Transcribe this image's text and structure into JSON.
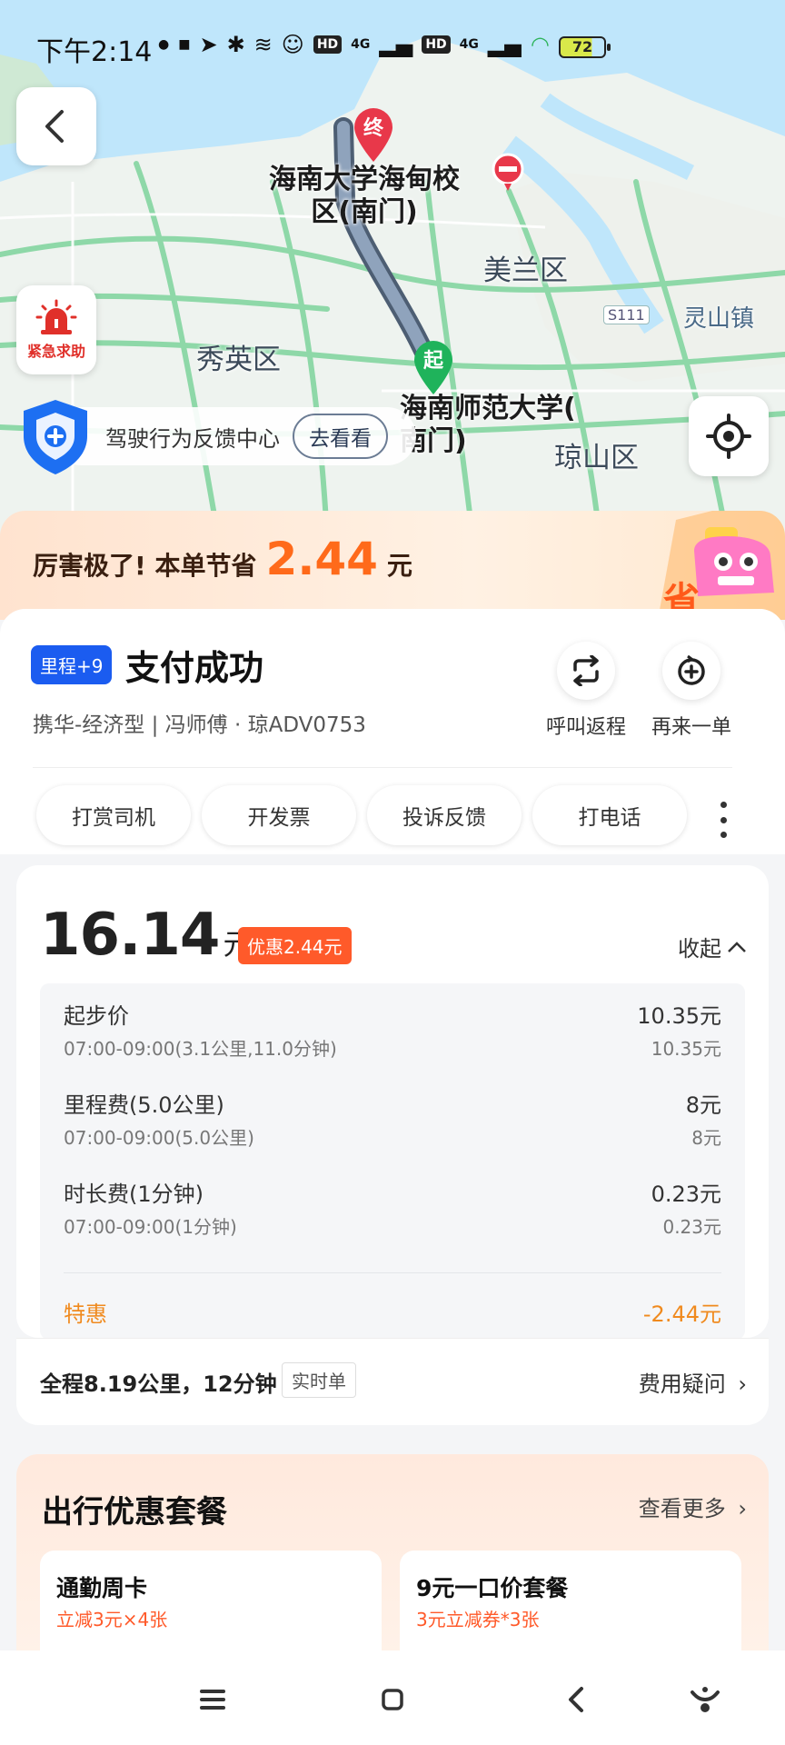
{
  "status_bar": {
    "time": "下午2:14",
    "net1": "4G",
    "net2": "4G",
    "hd": "HD",
    "battery": "72"
  },
  "map": {
    "labels": {
      "end_place": "海南大学海甸校\n区(南门)",
      "start_place": "海南师范大学(\n南门)",
      "district_meilan": "美兰区",
      "district_xiuying": "秀英区",
      "district_qiongshan": "琼山区",
      "town_lingshan": "灵山镇",
      "road_s111": "S111"
    },
    "end_pin": "终",
    "start_pin": "起",
    "sos_label": "紧急求助",
    "feedback": {
      "label": "驾驶行为反馈中心",
      "action": "去看看"
    }
  },
  "savings": {
    "prefix": "厉害极了! 本单节省",
    "amount": "2.44",
    "unit": "元"
  },
  "order": {
    "mileage_badge": "里程+9",
    "status": "支付成功",
    "subtitle": "携华-经济型 | 冯师傅 · 琼ADV0753",
    "return_trip": "呼叫返程",
    "reorder": "再来一单"
  },
  "actions": [
    "打赏司机",
    "开发票",
    "投诉反馈",
    "打电话"
  ],
  "fare": {
    "total": "16.14",
    "unit": "元",
    "discount_badge": "优惠2.44元",
    "collapse": "收起",
    "items": [
      {
        "label": "起步价",
        "value": "10.35元",
        "sub": "07:00-09:00(3.1公里,11.0分钟)",
        "sub_value": "10.35元"
      },
      {
        "label": "里程费(5.0公里)",
        "value": "8元",
        "sub": "07:00-09:00(5.0公里)",
        "sub_value": "8元"
      },
      {
        "label": "时长费(1分钟)",
        "value": "0.23元",
        "sub": "07:00-09:00(1分钟)",
        "sub_value": "0.23元"
      }
    ],
    "special": {
      "label": "特惠",
      "value": "-2.44元"
    }
  },
  "trip": {
    "summary": "全程8.19公里，12分钟",
    "tag": "实时单",
    "question": "费用疑问"
  },
  "package": {
    "title": "出行优惠套餐",
    "more": "查看更多",
    "items": [
      {
        "title": "通勤周卡",
        "sub": "立减3元×4张"
      },
      {
        "title": "9元一口价套餐",
        "sub": "3元立减券*3张"
      }
    ]
  },
  "colors": {
    "accent_blue": "#1b5cf0",
    "accent_orange": "#ff6a1a",
    "special_orange": "#f08a1e",
    "discount_red": "#ff5a2a"
  }
}
